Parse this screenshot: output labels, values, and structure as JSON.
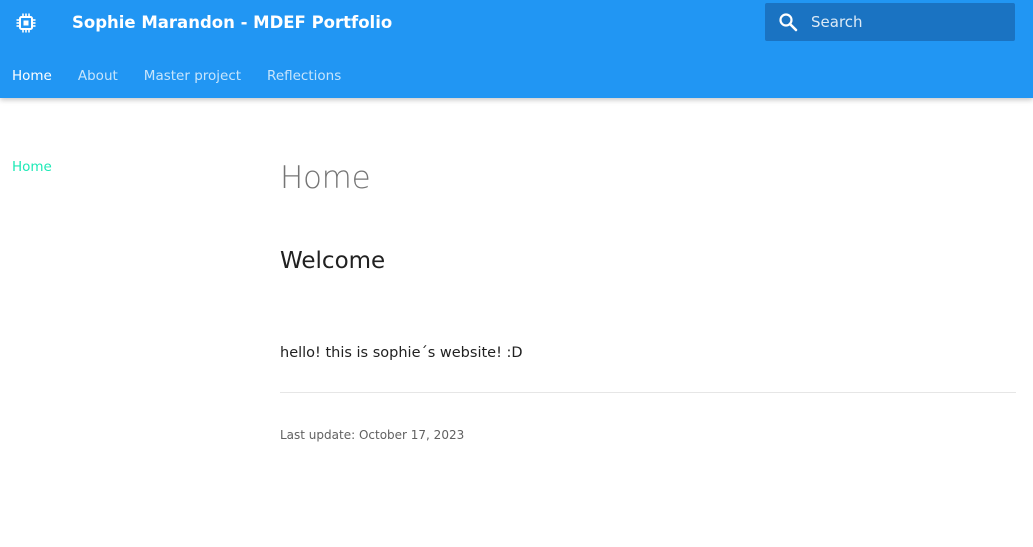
{
  "header": {
    "logo_icon": "chip-icon",
    "title": "Sophie Marandon - MDEF Portfolio",
    "background_color": "#2196f3"
  },
  "search": {
    "icon": "search-icon",
    "placeholder": "Search",
    "value": ""
  },
  "tabs": [
    {
      "label": "Home",
      "active": true
    },
    {
      "label": "About",
      "active": false
    },
    {
      "label": "Master project",
      "active": false
    },
    {
      "label": "Reflections",
      "active": false
    }
  ],
  "sidebar": {
    "items": [
      {
        "label": "Home",
        "active": true
      }
    ],
    "accent_color": "#1de9b6"
  },
  "main": {
    "title": "Home",
    "heading": "Welcome",
    "paragraph": "hello! this is sophie´s website! :D",
    "last_update": "Last update: October 17, 2023"
  }
}
